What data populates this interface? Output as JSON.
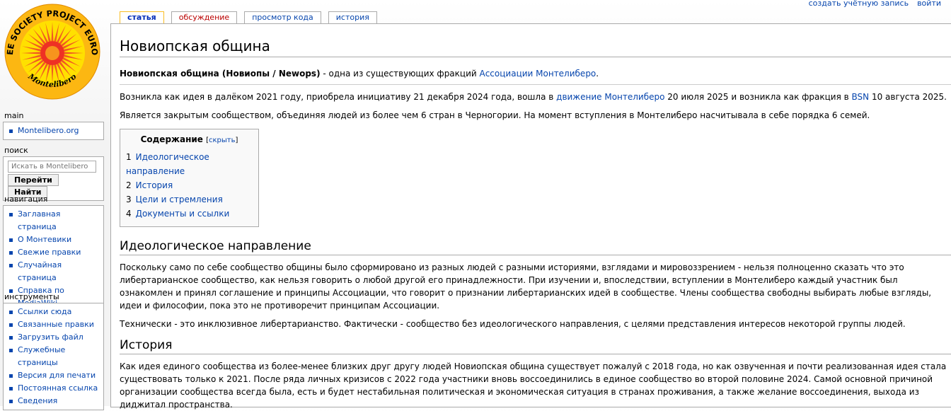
{
  "personal": {
    "create_account": "создать учётную запись",
    "login": "войти"
  },
  "logo": {
    "top_text": "FREE SOCIETY PROJECT EUROPE",
    "bottom_text": "Montelibero"
  },
  "tabs": [
    {
      "label": "статья",
      "selected": true
    },
    {
      "label": "обсуждение",
      "new": true
    },
    {
      "label": "просмотр кода"
    },
    {
      "label": "история"
    }
  ],
  "page": {
    "title": "Новиопская община",
    "lead": {
      "bold": "Новиопская община (Новиопы / Newops)",
      "text": " - одна из существующих фракций ",
      "link": "Ассоциации Монтелиберо",
      "end": "."
    },
    "p1": {
      "a": "Возникла как идея в далёком 2021 году, приобрела инициативу 21 декабря 2024 года, вошла в ",
      "link1": "движение Монтелиберо",
      "b": " 20 июля 2025 и возникла как фракция в ",
      "link2": "BSN",
      "c": " 10 августа 2025."
    },
    "p2": "Является закрытым сообществом, объединяя людей из более чем 6 стран в Черногории. На момент вступления в Монтелиберо насчитывала в себе порядка 6 семей.",
    "toc": {
      "title": "Содержание",
      "toggle": "скрыть",
      "items": [
        {
          "num": "1",
          "label": "Идеологическое направление"
        },
        {
          "num": "2",
          "label": "История"
        },
        {
          "num": "3",
          "label": "Цели и стремления"
        },
        {
          "num": "4",
          "label": "Документы и ссылки"
        }
      ]
    },
    "sections": [
      {
        "heading": "Идеологическое направление",
        "paragraphs": [
          "Поскольку само по себе сообщество общины было сформировано из разных людей с разными историями, взглядами и мировоззрением - нельзя полноценно сказать что это либертарианское сообщество, как нельзя говорить о любой другой его принадлежности. При изучении и, впоследствии, вступлении в Монтелиберо каждый участник был ознакомлен и принял соглашение и принципы Ассоциации, что говорит о признании либертарианских идей в сообществе. Члены сообщества свободны выбирать любые взгляды, идеи и философии, пока это не противоречит принципам Ассоциации.",
          "Технически - это инклюзивное либертарианство. Фактически - сообщество без идеологического направления, с целями представления интересов некоторой группы людей."
        ]
      },
      {
        "heading": "История",
        "paragraphs": [
          "Как идея единого сообщества из более-менее близких друг другу людей Новиопская община существует пожалуй с 2018 года, но как озвученная и почти реализованная идея стала существовать только к 2021. После ряда личных кризисов с 2022 года участники вновь воссоединились в единое сообщество во второй половине 2024. Самой основной причиной организации сообщества всегда была, есть и будет нестабильная политическая и экономическая ситуация в странах проживания, а также желание воссоединения, выхода из диджитал пространства."
        ]
      }
    ]
  },
  "sidebar": {
    "main": {
      "title": "main",
      "items": [
        "Montelibero.org"
      ]
    },
    "search": {
      "title": "поиск",
      "placeholder": "Искать в Montelibero",
      "go": "Перейти",
      "find": "Найти"
    },
    "navigation": {
      "title": "навигация",
      "items": [
        "Заглавная страница",
        "О Монтевики",
        "Свежие правки",
        "Случайная страница",
        "Справка по MediaWiki"
      ]
    },
    "tools": {
      "title": "инструменты",
      "items": [
        "Ссылки сюда",
        "Связанные правки",
        "Загрузить файл",
        "Служебные страницы",
        "Версия для печати",
        "Постоянная ссылка",
        "Сведения"
      ]
    }
  },
  "colors": {
    "link": "#0645ad",
    "new_link": "#ba0000",
    "logo_orange": "#f7941d",
    "logo_yellow": "#ffe000"
  }
}
